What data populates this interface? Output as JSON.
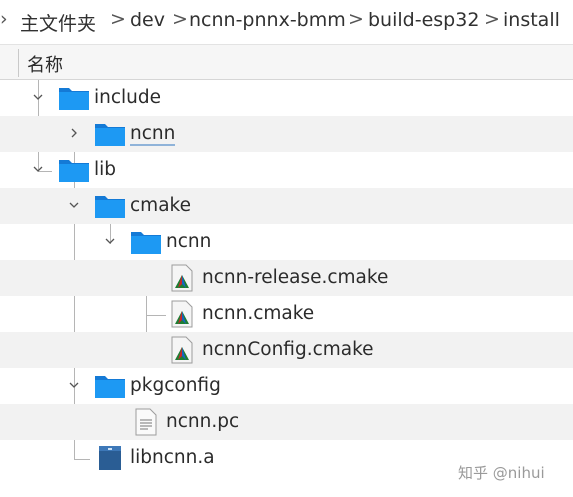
{
  "breadcrumb": {
    "items": [
      "主文件夹",
      "dev",
      "ncnn-pnnx-bmm",
      "build-esp32",
      "install"
    ],
    "separator": ">"
  },
  "header": {
    "column_name": "名称"
  },
  "tree": {
    "rows": [
      {
        "label": "include",
        "type": "folder",
        "state": "expanded"
      },
      {
        "label": "ncnn",
        "type": "folder",
        "state": "collapsed"
      },
      {
        "label": "lib",
        "type": "folder",
        "state": "expanded"
      },
      {
        "label": "cmake",
        "type": "folder",
        "state": "expanded"
      },
      {
        "label": "ncnn",
        "type": "folder",
        "state": "expanded"
      },
      {
        "label": "ncnn-release.cmake",
        "type": "cmake-file"
      },
      {
        "label": "ncnn.cmake",
        "type": "cmake-file"
      },
      {
        "label": "ncnnConfig.cmake",
        "type": "cmake-file"
      },
      {
        "label": "pkgconfig",
        "type": "folder",
        "state": "expanded"
      },
      {
        "label": "ncnn.pc",
        "type": "text-file"
      },
      {
        "label": "libncnn.a",
        "type": "archive-file"
      }
    ]
  },
  "watermark": "知乎 @nihui",
  "colors": {
    "folder": "#1d99f3",
    "folder_tab": "#147ad6",
    "row_alt": "#f2f2f2",
    "focus_underline": "#8fb3d9"
  }
}
